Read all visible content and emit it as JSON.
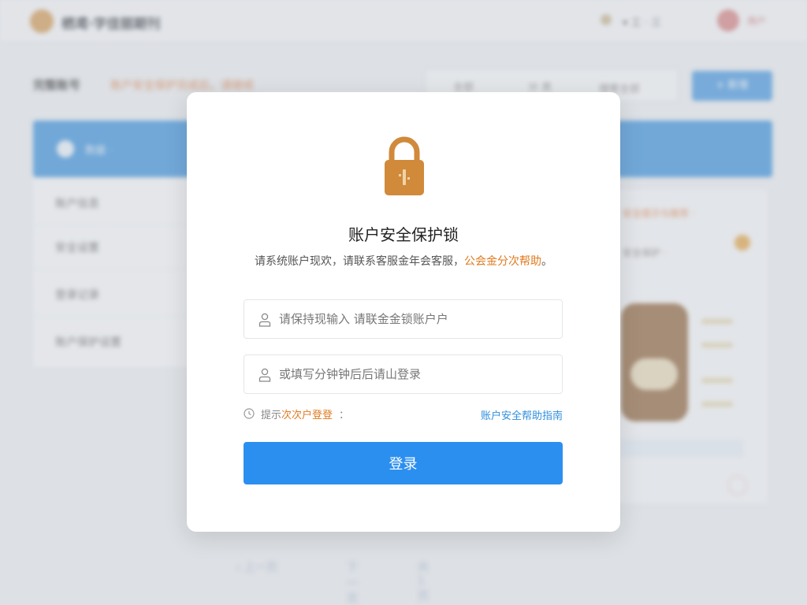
{
  "background": {
    "brand": "栖鸢·字佳丽期刊",
    "top_menu": "▾ 工 · 三",
    "user": "用户",
    "breadcrumb": "完整账号",
    "breadcrumb_highlight": "账户安全保护完成后，请继续",
    "toolbar": [
      "全部",
      "分 类",
      "搜索全部"
    ],
    "action_button": "+ 新增",
    "band_label": "数据 ·",
    "rows": [
      "账户信息",
      "安全设置",
      "登录记录",
      "账户保护设置"
    ],
    "side_title": "安全提示与推荐 ·",
    "side_text": "安全保护 ·",
    "pager": [
      "‹  上一页",
      "下一页",
      "共 1 页  ›"
    ]
  },
  "modal": {
    "title": "账户安全保护锁",
    "subtitle_prefix": "请系统账户现欢，请联系客服金年会客服，",
    "subtitle_highlight": "公会金分次帮助",
    "subtitle_suffix": "。",
    "account_placeholder": "请保持现输入 请联金金锁账户户",
    "code_placeholder": "或填写分钟钟后后请山登录",
    "remember_prefix": "提示",
    "remember_highlight": "次次户登登",
    "remember_suffix": "：",
    "forgot_link": "账户安全帮助指南",
    "login_button": "登录",
    "colors": {
      "lock": "#d08a3a",
      "accent_orange": "#e07a1f",
      "primary_blue": "#2b8ff0"
    },
    "icons": [
      "lock-icon",
      "user-icon",
      "clock-icon"
    ]
  }
}
